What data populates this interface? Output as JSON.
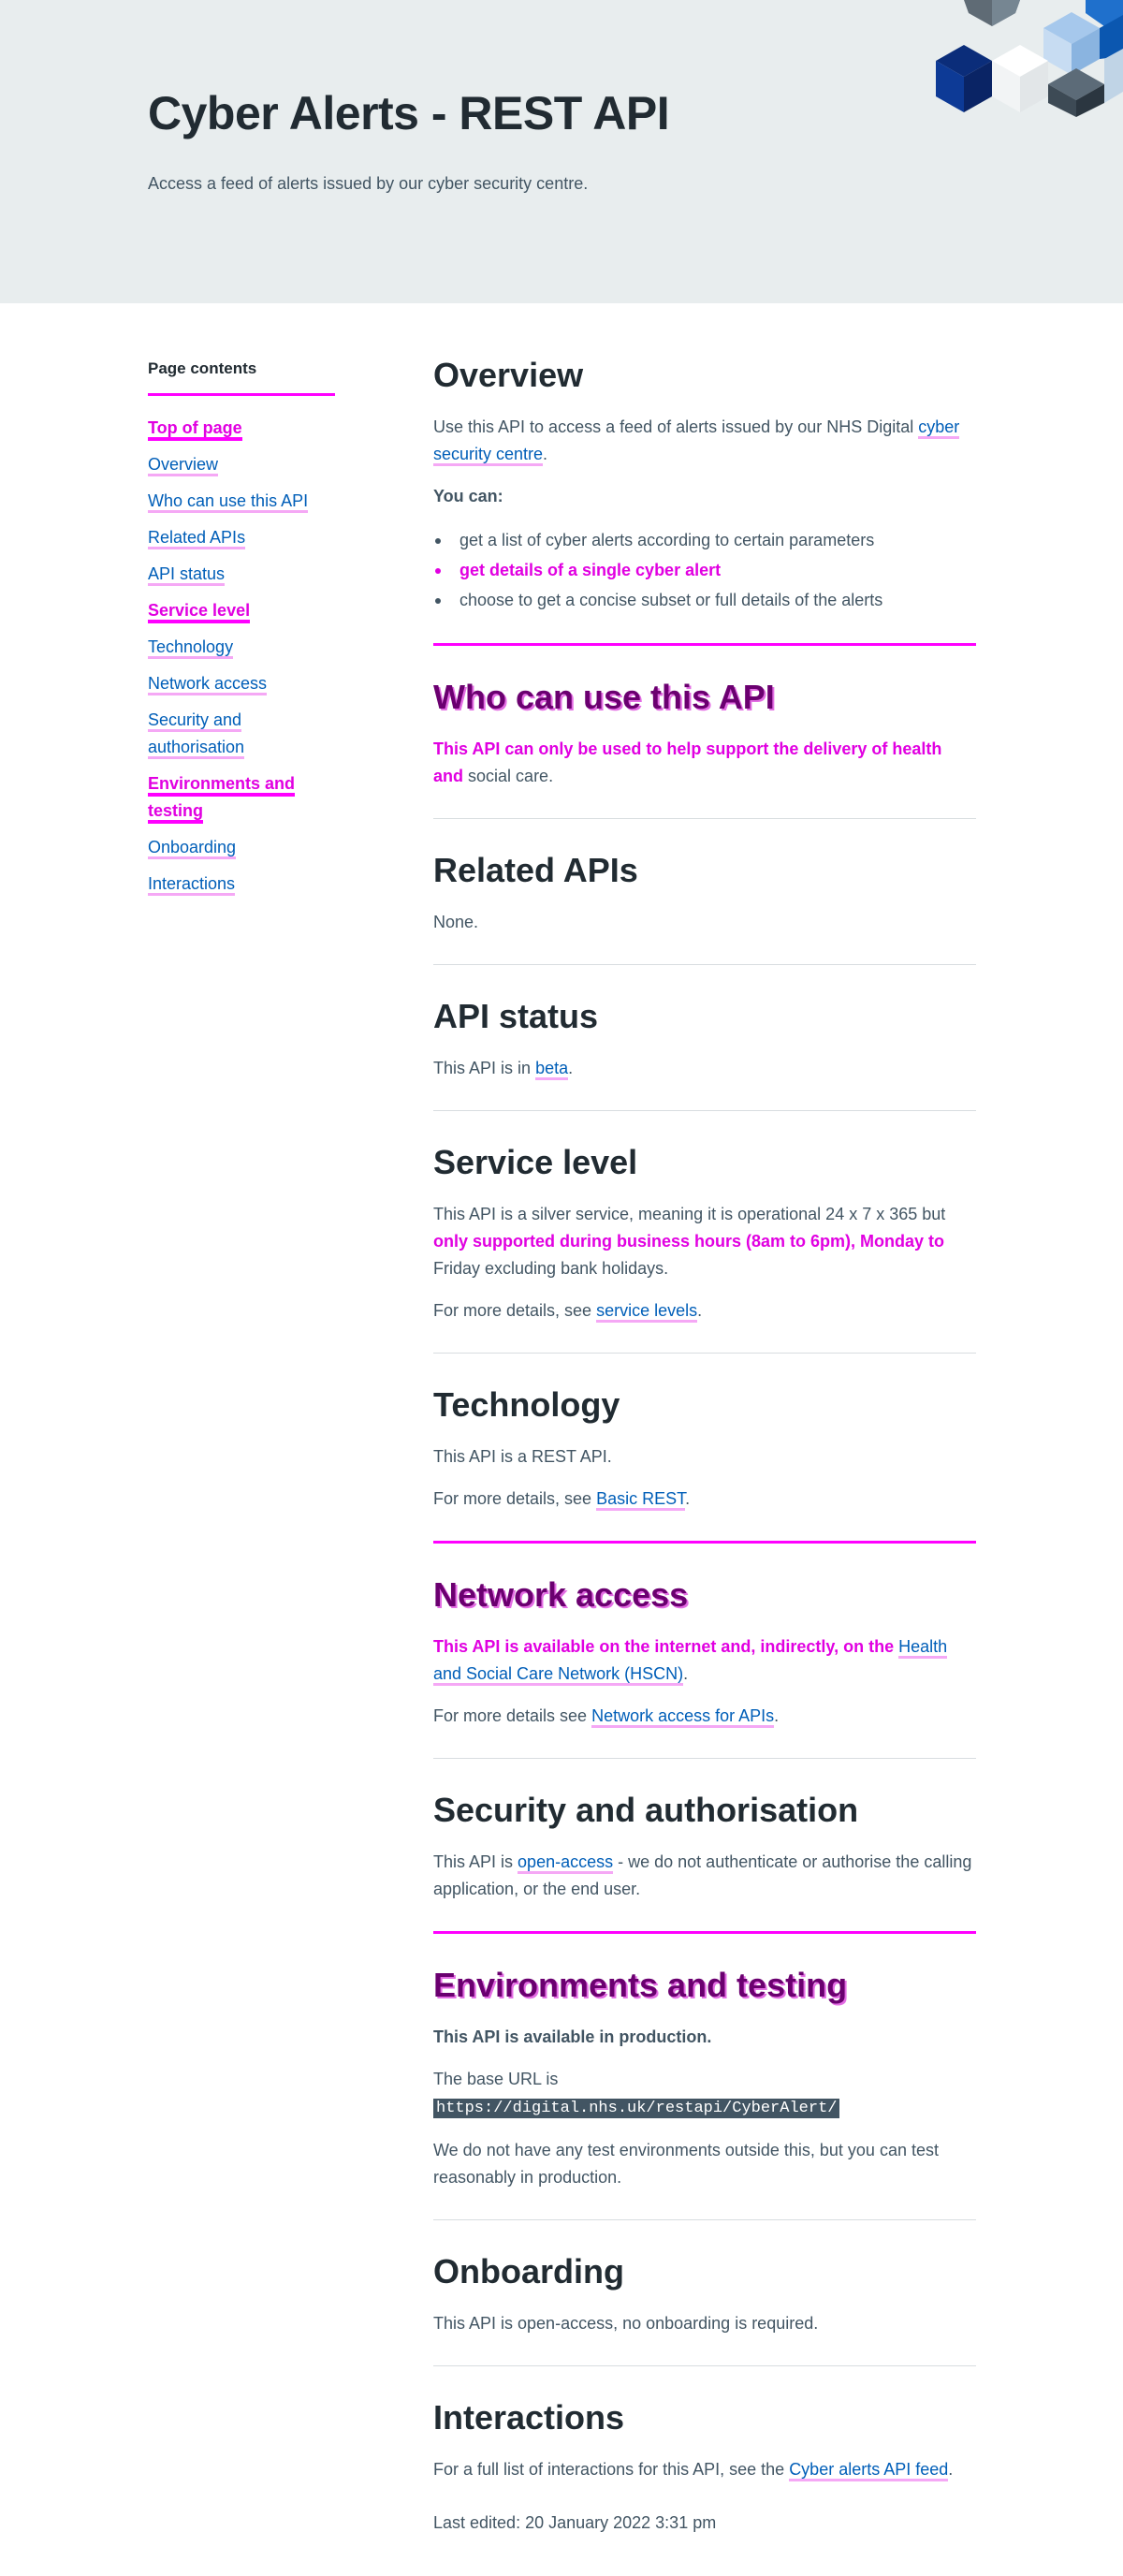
{
  "header": {
    "title": "Cyber Alerts - REST API",
    "description": "Access a feed of alerts issued by our cyber security centre."
  },
  "sidebar": {
    "heading": "Page contents",
    "items": [
      {
        "label": "Top of page"
      },
      {
        "label": "Overview"
      },
      {
        "label": "Who can use this API"
      },
      {
        "label": "Related APIs"
      },
      {
        "label": "API status"
      },
      {
        "label": "Service level"
      },
      {
        "label": "Technology"
      },
      {
        "label": "Network access"
      },
      {
        "label": "Security and authorisation"
      },
      {
        "label": "Environments and testing"
      },
      {
        "label": "Onboarding"
      },
      {
        "label": "Interactions"
      }
    ]
  },
  "overview": {
    "heading": "Overview",
    "intro": "Use this API to access a feed of alerts issued by our NHS Digital",
    "link": "cyber security centre",
    "end": ".",
    "you_can": "You can:",
    "bullets": [
      "get a list of cyber alerts according to certain parameters",
      "get details of a single cyber alert",
      "choose to get a concise subset or full details of the alerts"
    ]
  },
  "who": {
    "heading": "Who can use this API",
    "text_hl": "This API can only be used to help support the delivery of health and",
    "text_rest": "social care."
  },
  "related": {
    "heading": "Related APIs",
    "text": "None."
  },
  "status": {
    "heading": "API status",
    "pre": "This API is in",
    "link": "beta",
    "end": "."
  },
  "service": {
    "heading": "Service level",
    "text1": "This API is a silver service, meaning it is operational 24 x 7 x 365 but",
    "text_hl": "only supported during business hours (8am to 6pm), Monday to",
    "text2": "Friday excluding bank holidays.",
    "more_pre": "For more details, see",
    "more_link": "service levels",
    "end": "."
  },
  "technology": {
    "heading": "Technology",
    "text": "This API is a REST API.",
    "more_pre": "For more details, see",
    "more_link": "Basic REST",
    "end": "."
  },
  "network": {
    "heading": "Network access",
    "text_hl": "This API is available on the internet and, indirectly, on the",
    "link": "Health and Social Care Network (HSCN)",
    "end": ".",
    "more_pre": "For more details see",
    "more_link": "Network access for APIs",
    "more_end": "."
  },
  "security": {
    "heading": "Security and authorisation",
    "pre": "This API is",
    "link": "open-access",
    "post": "- we do not authenticate or authorise the calling application, or the end user."
  },
  "environments": {
    "heading": "Environments and testing",
    "text_hl": "This API is available in production.",
    "base_pre": "The base URL is",
    "base_url": "https://digital.nhs.uk/restapi/CyberAlert/",
    "text2": "We do not have any test environments outside this, but you can test reasonably in production."
  },
  "onboarding": {
    "heading": "Onboarding",
    "text": "This API is open-access, no onboarding is required."
  },
  "interactions": {
    "heading": "Interactions",
    "pre": "For a full list of interactions for this API, see the",
    "link": "Cyber alerts API feed",
    "end": "."
  },
  "footer": {
    "last_edited": "Last edited: 20 January 2022 3:31 pm"
  }
}
